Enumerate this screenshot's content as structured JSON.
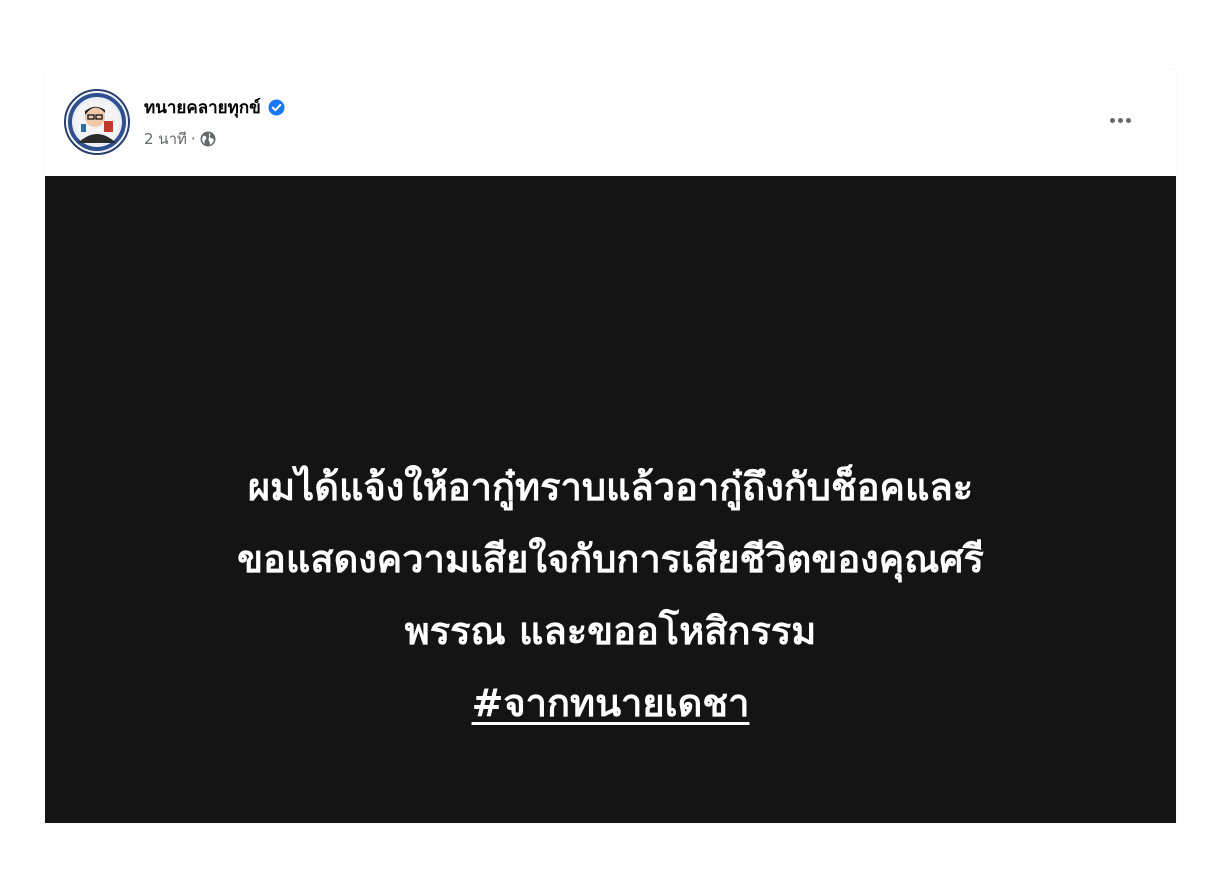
{
  "post": {
    "author_name": "ทนายคลายทุกข์",
    "verified": true,
    "timestamp": "2 นาที",
    "separator": "·",
    "audience_icon": "globe-icon",
    "more_icon": "more-options-icon",
    "image_text": {
      "line1": "ผมได้แจ้งให้อากู๋ทราบแล้วอากู๋ถึงกับช็อคและ",
      "line2": "ขอแสดงความเสียใจกับการเสียชีวิตของคุณศรี",
      "line3": "พรรณ และขออโหสิกรรม",
      "hashtag": "#จากทนายเดชา"
    }
  },
  "colors": {
    "verified_blue": "#1877f2",
    "image_background": "#141414",
    "meta_gray": "#65676b",
    "text_white": "#ffffff"
  }
}
